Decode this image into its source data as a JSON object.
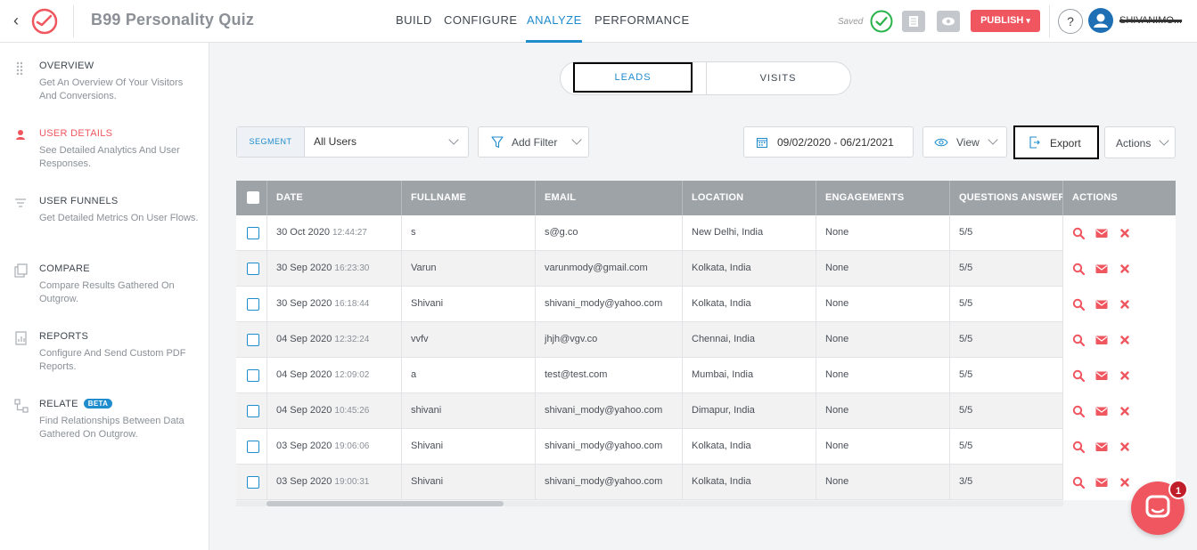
{
  "header": {
    "back_icon": "chevron-left-icon",
    "logo_icon": "outgrow-logo-icon",
    "title": "B99 Personality Quiz",
    "tabs": [
      {
        "label": "BUILD",
        "active": false
      },
      {
        "label": "CONFIGURE",
        "active": false
      },
      {
        "label": "ANALYZE",
        "active": true
      },
      {
        "label": "PERFORMANCE",
        "active": false
      }
    ],
    "saved_text": "Saved",
    "saved_icon": "check-circle-icon",
    "publish_label": "PUBLISH",
    "help_label": "?",
    "user_name": "SHIVANIMO...",
    "accent_color": "#1f8ccd",
    "publish_color": "#f0565f"
  },
  "sidebar": {
    "items": [
      {
        "title": "OVERVIEW",
        "desc": "Get An Overview Of Your Visitors And Conversions.",
        "icon": "grid-dots-icon",
        "active": false
      },
      {
        "title": "USER DETAILS",
        "desc": "See Detailed Analytics And User Responses.",
        "icon": "user-icon",
        "active": true
      },
      {
        "title": "USER FUNNELS",
        "desc": "Get Detailed Metrics On User Flows.",
        "icon": "funnel-lines-icon",
        "active": false
      },
      {
        "title": "COMPARE",
        "desc": "Compare Results Gathered On Outgrow.",
        "icon": "compare-icon",
        "active": false
      },
      {
        "title": "REPORTS",
        "desc": "Configure And Send Custom PDF Reports.",
        "icon": "report-icon",
        "active": false
      },
      {
        "title": "RELATE",
        "badge": "BETA",
        "desc": "Find Relationships Between Data Gathered On Outgrow.",
        "icon": "relate-icon",
        "active": false
      }
    ]
  },
  "toggle": {
    "leads": "LEADS",
    "visits": "VISITS"
  },
  "filters": {
    "segment_label": "SEGMENT",
    "segment_value": "All Users",
    "add_filter": "Add Filter",
    "date_range": "09/02/2020 - 06/21/2021",
    "view": "View",
    "export": "Export",
    "actions": "Actions"
  },
  "table": {
    "headers": [
      "DATE",
      "FULLNAME",
      "EMAIL",
      "LOCATION",
      "ENGAGEMENTS",
      "QUESTIONS ANSWERED",
      "ACTIONS"
    ],
    "rows": [
      {
        "date": "30 Oct 2020",
        "time": "12:44:27",
        "name": "s",
        "email": "s@g.co",
        "location": "New Delhi, India",
        "engagements": "None",
        "questions": "5/5"
      },
      {
        "date": "30 Sep 2020",
        "time": "16:23:30",
        "name": "Varun",
        "email": "varunmody@gmail.com",
        "location": "Kolkata, India",
        "engagements": "None",
        "questions": "5/5"
      },
      {
        "date": "30 Sep 2020",
        "time": "16:18:44",
        "name": "Shivani",
        "email": "shivani_mody@yahoo.com",
        "location": "Kolkata, India",
        "engagements": "None",
        "questions": "5/5"
      },
      {
        "date": "04 Sep 2020",
        "time": "12:32:24",
        "name": "vvfv",
        "email": "jhjh@vgv.co",
        "location": "Chennai, India",
        "engagements": "None",
        "questions": "5/5"
      },
      {
        "date": "04 Sep 2020",
        "time": "12:09:02",
        "name": "a",
        "email": "test@test.com",
        "location": "Mumbai, India",
        "engagements": "None",
        "questions": "5/5"
      },
      {
        "date": "04 Sep 2020",
        "time": "10:45:26",
        "name": "shivani",
        "email": "shivani_mody@yahoo.com",
        "location": "Dimapur, India",
        "engagements": "None",
        "questions": "5/5"
      },
      {
        "date": "03 Sep 2020",
        "time": "19:06:06",
        "name": "Shivani",
        "email": "shivani_mody@yahoo.com",
        "location": "Kolkata, India",
        "engagements": "None",
        "questions": "5/5"
      },
      {
        "date": "03 Sep 2020",
        "time": "19:00:31",
        "name": "Shivani",
        "email": "shivani_mody@yahoo.com",
        "location": "Kolkata, India",
        "engagements": "None",
        "questions": "3/5"
      }
    ],
    "row_action_icons": [
      "search-icon",
      "mail-icon",
      "close-icon"
    ],
    "action_color": "#f0565f"
  },
  "chat": {
    "badge": "1",
    "icon": "chat-icon"
  }
}
